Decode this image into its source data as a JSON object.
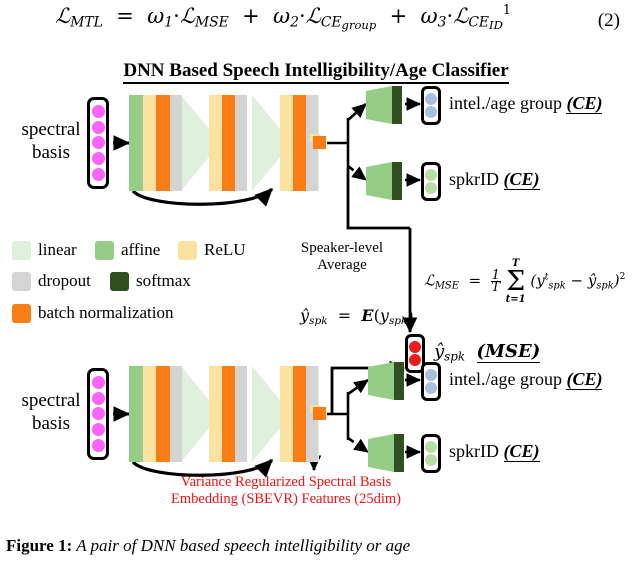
{
  "equation_2": {
    "number": "(2)",
    "lhs": "L_MTL",
    "full_text": "L_MTL = ω1·L_MSE + ω2·L_CE_group + ω3·L_CE_ID ^1",
    "terms": [
      {
        "weight": "ω1",
        "loss": "L",
        "loss_sub": "MSE"
      },
      {
        "weight": "ω2",
        "loss": "L",
        "loss_sub": "CE",
        "loss_subsub": "group"
      },
      {
        "weight": "ω3",
        "loss": "L",
        "loss_sub": "CE",
        "loss_subsub": "ID",
        "superscript": "1"
      }
    ]
  },
  "diagram_title": "DNN Based Speech Intelligibility/Age Classifier",
  "networks": {
    "upper": {
      "input_label_line1": "spectral",
      "input_label_line2": "basis",
      "input_units": 5,
      "outputs": [
        {
          "label": "intel./age group",
          "loss": "(CE)",
          "dot_color": "#aabfe0",
          "underlined": true
        },
        {
          "label": "spkrID",
          "loss": "(CE)",
          "dot_color": "#b9dba6",
          "underlined": true
        }
      ]
    },
    "lower": {
      "input_label_line1": "spectral",
      "input_label_line2": "basis",
      "input_units": 5,
      "outputs": [
        {
          "label": "ŷ_spk",
          "loss": "(MSE)",
          "dot_color": "#ef1b1b",
          "underlined": true
        },
        {
          "label": "intel./age group",
          "loss": "(CE)",
          "dot_color": "#aabfe0",
          "underlined": true
        },
        {
          "label": "spkrID",
          "loss": "(CE)",
          "dot_color": "#b9dba6",
          "underlined": false
        }
      ]
    }
  },
  "legend": {
    "items": [
      {
        "name": "linear",
        "color": "#dff0dc"
      },
      {
        "name": "affine",
        "color": "#96cd86"
      },
      {
        "name": "ReLU",
        "color": "#fce2a0"
      },
      {
        "name": "dropout",
        "color": "#d4d4d4"
      },
      {
        "name": "softmax",
        "color": "#2f5120"
      },
      {
        "name": "batch normalization",
        "color": "#f97d15"
      }
    ]
  },
  "annotations": {
    "speaker_average_line1": "Speaker-level",
    "speaker_average_line2": "Average",
    "y_hat_formula": "ŷ_spk = E(y_spk)",
    "mse_equation": "L_MSE = (1/T) Σ_{t=1}^{T} (y^t_spk − ŷ_spk)²",
    "mse_parts": {
      "lhs": "L",
      "lhs_sub": "MSE",
      "eq": "=",
      "frac_num": "1",
      "frac_den": "T",
      "sum_upper": "T",
      "sum_lower": "t=1",
      "body": "(y t spk − ŷ spk)",
      "power": "2"
    },
    "red_caption_line1": "Variance Regularized Spectral Basis",
    "red_caption_line2": "Embedding (SBEVR) Features (25dim)"
  },
  "figure_caption": {
    "label": "Figure 1:",
    "text": "A pair of DNN based speech intelligibility or age"
  },
  "colors": {
    "linear": "#dff0dc",
    "affine": "#96cd86",
    "relu": "#fce2a0",
    "dropout": "#d4d4d4",
    "softmax": "#2f5120",
    "batchnorm": "#f97d15",
    "input_dot": "#fb63fb",
    "red_text": "#fb0f0f"
  }
}
